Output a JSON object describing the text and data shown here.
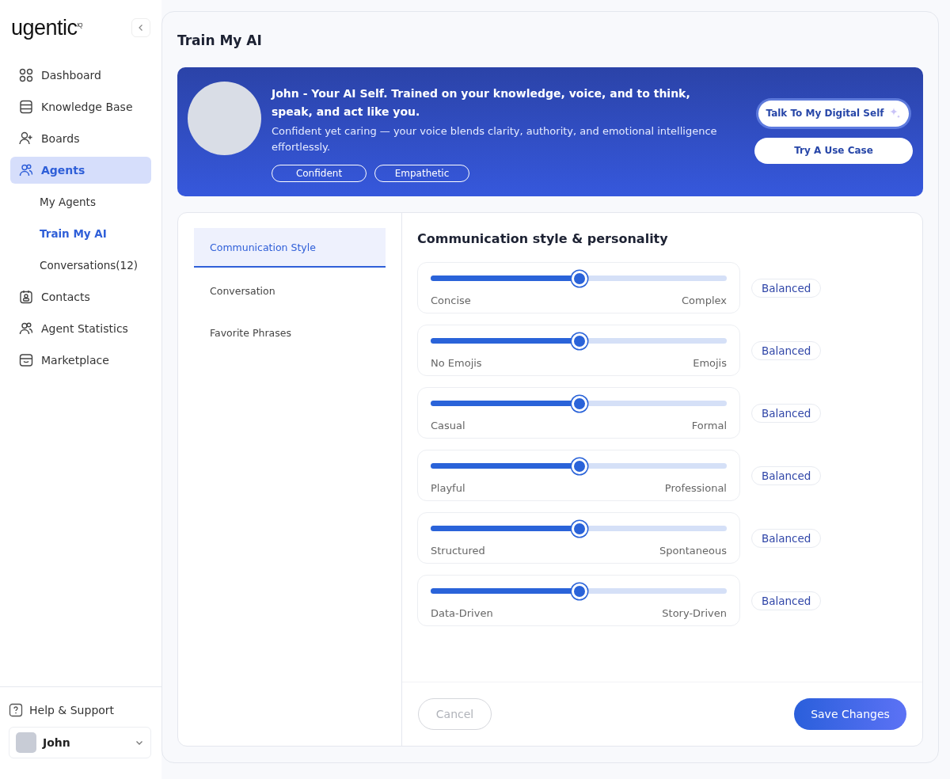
{
  "sidebar": {
    "logo": "ugentic",
    "logo_mark": "IQ",
    "items": [
      {
        "label": "Dashboard",
        "selected": false
      },
      {
        "label": "Knowledge Base",
        "selected": false
      },
      {
        "label": "Boards",
        "selected": false
      },
      {
        "label": "Agents",
        "selected": true,
        "children": [
          {
            "label": "My Agents",
            "selected": false
          },
          {
            "label": "Train My AI",
            "selected": true
          },
          {
            "label": "Conversations(12)",
            "selected": false
          }
        ]
      },
      {
        "label": "Contacts",
        "selected": false
      },
      {
        "label": "Agent Statistics",
        "selected": false
      },
      {
        "label": "Marketplace",
        "selected": false
      }
    ],
    "help": "Help & Support",
    "user": "John"
  },
  "page_title": "Train My AI",
  "banner": {
    "headline": "John - Your AI Self. Trained on your knowledge, voice, and to think, speak, and act like you.",
    "description": "Confident yet caring — your voice blends clarity, authority, and emotional intelligence effortlessly.",
    "tags": [
      "Confident",
      "Empathetic"
    ],
    "buttons": [
      "Talk To My Digital Self",
      "Try A Use Case"
    ]
  },
  "tabs": [
    {
      "label": "Communication Style",
      "selected": true
    },
    {
      "label": "Conversation",
      "selected": false
    },
    {
      "label": "Favorite Phrases",
      "selected": false
    }
  ],
  "section_title": "Communication style & personality",
  "sliders": [
    {
      "left": "Concise",
      "right": "Complex",
      "level": 0.5,
      "value": "Balanced"
    },
    {
      "left": "No Emojis",
      "right": "Emojis",
      "level": 0.5,
      "value": "Balanced"
    },
    {
      "left": "Casual",
      "right": "Formal",
      "level": 0.5,
      "value": "Balanced"
    },
    {
      "left": "Playful",
      "right": "Professional",
      "level": 0.5,
      "value": "Balanced"
    },
    {
      "left": "Structured",
      "right": "Spontaneous",
      "level": 0.5,
      "value": "Balanced"
    },
    {
      "left": "Data-Driven",
      "right": "Story-Driven",
      "level": 0.5,
      "value": "Balanced"
    }
  ],
  "footer": {
    "cancel": "Cancel",
    "save": "Save Changes"
  }
}
